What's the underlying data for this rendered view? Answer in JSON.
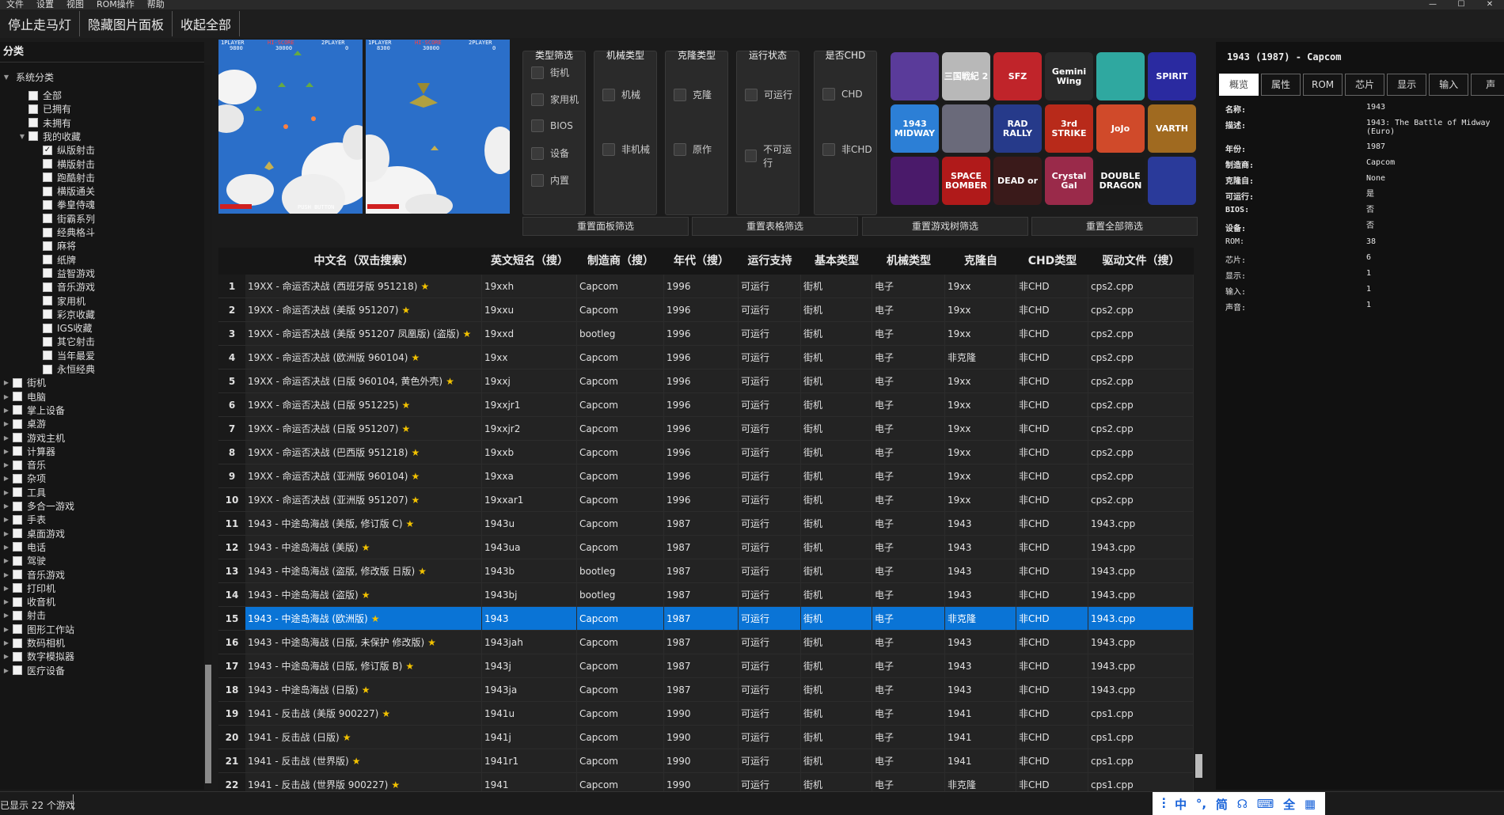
{
  "menu": [
    "文件",
    "设置",
    "视图",
    "ROM操作",
    "帮助"
  ],
  "window_controls": [
    "—",
    "☐",
    "✕"
  ],
  "toolbar": [
    "停止走马灯",
    "隐藏图片面板",
    "收起全部"
  ],
  "sidebar": {
    "title": "分类",
    "root": "系统分类",
    "items": [
      {
        "label": "全部",
        "level": 1,
        "checked": false,
        "arrow": ""
      },
      {
        "label": "已拥有",
        "level": 1,
        "checked": false,
        "arrow": ""
      },
      {
        "label": "未拥有",
        "level": 1,
        "checked": false,
        "arrow": ""
      },
      {
        "label": "我的收藏",
        "level": 1,
        "checked": false,
        "arrow": "▼"
      },
      {
        "label": "纵版射击",
        "level": 2,
        "checked": true,
        "arrow": ""
      },
      {
        "label": "横版射击",
        "level": 2,
        "checked": false,
        "arrow": ""
      },
      {
        "label": "跑酷射击",
        "level": 2,
        "checked": false,
        "arrow": ""
      },
      {
        "label": "横版通关",
        "level": 2,
        "checked": false,
        "arrow": ""
      },
      {
        "label": "拳皇侍魂",
        "level": 2,
        "checked": false,
        "arrow": ""
      },
      {
        "label": "街霸系列",
        "level": 2,
        "checked": false,
        "arrow": ""
      },
      {
        "label": "经典格斗",
        "level": 2,
        "checked": false,
        "arrow": ""
      },
      {
        "label": "麻将",
        "level": 2,
        "checked": false,
        "arrow": ""
      },
      {
        "label": "纸牌",
        "level": 2,
        "checked": false,
        "arrow": ""
      },
      {
        "label": "益智游戏",
        "level": 2,
        "checked": false,
        "arrow": ""
      },
      {
        "label": "音乐游戏",
        "level": 2,
        "checked": false,
        "arrow": ""
      },
      {
        "label": "家用机",
        "level": 2,
        "checked": false,
        "arrow": ""
      },
      {
        "label": "彩京收藏",
        "level": 2,
        "checked": false,
        "arrow": ""
      },
      {
        "label": "IGS收藏",
        "level": 2,
        "checked": false,
        "arrow": ""
      },
      {
        "label": "其它射击",
        "level": 2,
        "checked": false,
        "arrow": ""
      },
      {
        "label": "当年最爱",
        "level": 2,
        "checked": false,
        "arrow": ""
      },
      {
        "label": "永恒经典",
        "level": 2,
        "checked": false,
        "arrow": ""
      },
      {
        "label": "街机",
        "level": 0,
        "checked": false,
        "arrow": "▶"
      },
      {
        "label": "电脑",
        "level": 0,
        "checked": false,
        "arrow": "▶"
      },
      {
        "label": "掌上设备",
        "level": 0,
        "checked": false,
        "arrow": "▶"
      },
      {
        "label": "桌游",
        "level": 0,
        "checked": false,
        "arrow": "▶"
      },
      {
        "label": "游戏主机",
        "level": 0,
        "checked": false,
        "arrow": "▶"
      },
      {
        "label": "计算器",
        "level": 0,
        "checked": false,
        "arrow": "▶"
      },
      {
        "label": "音乐",
        "level": 0,
        "checked": false,
        "arrow": "▶"
      },
      {
        "label": "杂项",
        "level": 0,
        "checked": false,
        "arrow": "▶"
      },
      {
        "label": "工具",
        "level": 0,
        "checked": false,
        "arrow": "▶"
      },
      {
        "label": "多合一游戏",
        "level": 0,
        "checked": false,
        "arrow": "▶"
      },
      {
        "label": "手表",
        "level": 0,
        "checked": false,
        "arrow": "▶"
      },
      {
        "label": "桌面游戏",
        "level": 0,
        "checked": false,
        "arrow": "▶"
      },
      {
        "label": "电话",
        "level": 0,
        "checked": false,
        "arrow": "▶"
      },
      {
        "label": "驾驶",
        "level": 0,
        "checked": false,
        "arrow": "▶"
      },
      {
        "label": "音乐游戏",
        "level": 0,
        "checked": false,
        "arrow": "▶"
      },
      {
        "label": "打印机",
        "level": 0,
        "checked": false,
        "arrow": "▶"
      },
      {
        "label": "收音机",
        "level": 0,
        "checked": false,
        "arrow": "▶"
      },
      {
        "label": "射击",
        "level": 0,
        "checked": false,
        "arrow": "▶"
      },
      {
        "label": "图形工作站",
        "level": 0,
        "checked": false,
        "arrow": "▶"
      },
      {
        "label": "数码相机",
        "level": 0,
        "checked": false,
        "arrow": "▶"
      },
      {
        "label": "数字模拟器",
        "level": 0,
        "checked": false,
        "arrow": "▶"
      },
      {
        "label": "医疗设备",
        "level": 0,
        "checked": false,
        "arrow": "▶"
      }
    ]
  },
  "screenshots": [
    {
      "p1": "1PLAYER",
      "hi": "HI-SCORE",
      "p2": "2PLAYER",
      "s1": "9800",
      "shi": "30000",
      "s2": "0",
      "footer": "PUSH BUTTON"
    },
    {
      "p1": "1PLAYER",
      "hi": "HI-SCORE",
      "p2": "2PLAYER",
      "s1": "8300",
      "shi": "30000",
      "s2": "0",
      "footer": ""
    }
  ],
  "filters": [
    {
      "title": "类型筛选",
      "options": [
        "街机",
        "家用机",
        "BIOS",
        "设备",
        "内置"
      ]
    },
    {
      "title": "机械类型",
      "options": [
        "机械",
        "非机械"
      ]
    },
    {
      "title": "克隆类型",
      "options": [
        "克隆",
        "原作"
      ]
    },
    {
      "title": "运行状态",
      "options": [
        "可运行",
        "不可运行"
      ]
    },
    {
      "title": "是否CHD",
      "options": [
        "CHD",
        "非CHD"
      ]
    }
  ],
  "reset_buttons": [
    "重置面板筛选",
    "重置表格筛选",
    "重置游戏树筛选",
    "重置全部筛选"
  ],
  "covers": [
    {
      "label": "",
      "bg": "#5a3b9a"
    },
    {
      "label": "三国戦紀 2",
      "bg": "#b8b8b8"
    },
    {
      "label": "SFZ",
      "bg": "#c0242a"
    },
    {
      "label": "Gemini Wing",
      "bg": "#2a2a2a"
    },
    {
      "label": "",
      "bg": "#2fa8a0"
    },
    {
      "label": "SPIRIT",
      "bg": "#2a2aa0"
    },
    {
      "label": "1943 MIDWAY",
      "bg": "#2c7fd6"
    },
    {
      "label": "",
      "bg": "#6a6a7a"
    },
    {
      "label": "RAD RALLY",
      "bg": "#263a8a"
    },
    {
      "label": "3rd STRIKE",
      "bg": "#b82a1a"
    },
    {
      "label": "JoJo",
      "bg": "#d04a2a"
    },
    {
      "label": "VARTH",
      "bg": "#a06a20"
    },
    {
      "label": "",
      "bg": "#4a1a6a"
    },
    {
      "label": "SPACE BOMBER",
      "bg": "#b01a1a"
    },
    {
      "label": "DEAD or",
      "bg": "#3a1a1a"
    },
    {
      "label": "Crystal Gal",
      "bg": "#9a2a4a"
    },
    {
      "label": "DOUBLE DRAGON",
      "bg": "#1a1a1a"
    },
    {
      "label": "",
      "bg": "#2a3a9a"
    }
  ],
  "table": {
    "columns": [
      "",
      "中文名（双击搜索）",
      "英文短名（搜）",
      "制造商（搜）",
      "年代（搜）",
      "运行支持",
      "基本类型",
      "机械类型",
      "克隆自",
      "CHD类型",
      "驱动文件（搜）"
    ],
    "rows": [
      [
        "1",
        "19XX - 命运否决战 (西班牙版 951218)",
        "19xxh",
        "Capcom",
        "1996",
        "可运行",
        "街机",
        "电子",
        "19xx",
        "非CHD",
        "cps2.cpp"
      ],
      [
        "2",
        "19XX - 命运否决战 (美版 951207)",
        "19xxu",
        "Capcom",
        "1996",
        "可运行",
        "街机",
        "电子",
        "19xx",
        "非CHD",
        "cps2.cpp"
      ],
      [
        "3",
        "19XX - 命运否决战 (美版 951207 凤凰版) (盗版)",
        "19xxd",
        "bootleg",
        "1996",
        "可运行",
        "街机",
        "电子",
        "19xx",
        "非CHD",
        "cps2.cpp"
      ],
      [
        "4",
        "19XX - 命运否决战 (欧洲版 960104)",
        "19xx",
        "Capcom",
        "1996",
        "可运行",
        "街机",
        "电子",
        "非克隆",
        "非CHD",
        "cps2.cpp"
      ],
      [
        "5",
        "19XX - 命运否决战 (日版 960104, 黄色外壳)",
        "19xxj",
        "Capcom",
        "1996",
        "可运行",
        "街机",
        "电子",
        "19xx",
        "非CHD",
        "cps2.cpp"
      ],
      [
        "6",
        "19XX - 命运否决战 (日版 951225)",
        "19xxjr1",
        "Capcom",
        "1996",
        "可运行",
        "街机",
        "电子",
        "19xx",
        "非CHD",
        "cps2.cpp"
      ],
      [
        "7",
        "19XX - 命运否决战 (日版 951207)",
        "19xxjr2",
        "Capcom",
        "1996",
        "可运行",
        "街机",
        "电子",
        "19xx",
        "非CHD",
        "cps2.cpp"
      ],
      [
        "8",
        "19XX - 命运否决战 (巴西版 951218)",
        "19xxb",
        "Capcom",
        "1996",
        "可运行",
        "街机",
        "电子",
        "19xx",
        "非CHD",
        "cps2.cpp"
      ],
      [
        "9",
        "19XX - 命运否决战 (亚洲版 960104)",
        "19xxa",
        "Capcom",
        "1996",
        "可运行",
        "街机",
        "电子",
        "19xx",
        "非CHD",
        "cps2.cpp"
      ],
      [
        "10",
        "19XX - 命运否决战 (亚洲版 951207)",
        "19xxar1",
        "Capcom",
        "1996",
        "可运行",
        "街机",
        "电子",
        "19xx",
        "非CHD",
        "cps2.cpp"
      ],
      [
        "11",
        "1943 - 中途岛海战 (美版, 修订版 C)",
        "1943u",
        "Capcom",
        "1987",
        "可运行",
        "街机",
        "电子",
        "1943",
        "非CHD",
        "1943.cpp"
      ],
      [
        "12",
        "1943 - 中途岛海战 (美版)",
        "1943ua",
        "Capcom",
        "1987",
        "可运行",
        "街机",
        "电子",
        "1943",
        "非CHD",
        "1943.cpp"
      ],
      [
        "13",
        "1943 - 中途岛海战 (盗版, 修改版 日版)",
        "1943b",
        "bootleg",
        "1987",
        "可运行",
        "街机",
        "电子",
        "1943",
        "非CHD",
        "1943.cpp"
      ],
      [
        "14",
        "1943 - 中途岛海战 (盗版)",
        "1943bj",
        "bootleg",
        "1987",
        "可运行",
        "街机",
        "电子",
        "1943",
        "非CHD",
        "1943.cpp"
      ],
      [
        "15",
        "1943 - 中途岛海战 (欧洲版)",
        "1943",
        "Capcom",
        "1987",
        "可运行",
        "街机",
        "电子",
        "非克隆",
        "非CHD",
        "1943.cpp"
      ],
      [
        "16",
        "1943 - 中途岛海战 (日版, 未保护 修改版)",
        "1943jah",
        "Capcom",
        "1987",
        "可运行",
        "街机",
        "电子",
        "1943",
        "非CHD",
        "1943.cpp"
      ],
      [
        "17",
        "1943 - 中途岛海战 (日版, 修订版 B)",
        "1943j",
        "Capcom",
        "1987",
        "可运行",
        "街机",
        "电子",
        "1943",
        "非CHD",
        "1943.cpp"
      ],
      [
        "18",
        "1943 - 中途岛海战 (日版)",
        "1943ja",
        "Capcom",
        "1987",
        "可运行",
        "街机",
        "电子",
        "1943",
        "非CHD",
        "1943.cpp"
      ],
      [
        "19",
        "1941 - 反击战 (美版 900227)",
        "1941u",
        "Capcom",
        "1990",
        "可运行",
        "街机",
        "电子",
        "1941",
        "非CHD",
        "cps1.cpp"
      ],
      [
        "20",
        "1941 - 反击战 (日版)",
        "1941j",
        "Capcom",
        "1990",
        "可运行",
        "街机",
        "电子",
        "1941",
        "非CHD",
        "cps1.cpp"
      ],
      [
        "21",
        "1941 - 反击战 (世界版)",
        "1941r1",
        "Capcom",
        "1990",
        "可运行",
        "街机",
        "电子",
        "1941",
        "非CHD",
        "cps1.cpp"
      ],
      [
        "22",
        "1941 - 反击战 (世界版 900227)",
        "1941",
        "Capcom",
        "1990",
        "可运行",
        "街机",
        "电子",
        "非克隆",
        "非CHD",
        "cps1.cpp"
      ]
    ],
    "selected_row": 15,
    "star": "★"
  },
  "details": {
    "title": "1943 (1987) - Capcom",
    "tabs": [
      "概览",
      "属性",
      "ROM",
      "芯片",
      "显示",
      "输入",
      "声"
    ],
    "active_tab": "概览",
    "fields": [
      {
        "key": "名称:",
        "value": "1943",
        "bold": true
      },
      {
        "key": "描述:",
        "value": "1943: The Battle of Midway (Euro)",
        "bold": true
      },
      {
        "key": "年份:",
        "value": "1987",
        "bold": true
      },
      {
        "key": "制造商:",
        "value": "Capcom",
        "bold": true
      },
      {
        "key": "克隆自:",
        "value": "None",
        "bold": true
      },
      {
        "key": "可运行:",
        "value": "是",
        "bold": true
      },
      {
        "key": "BIOS:",
        "value": "否",
        "bold": true
      },
      {
        "key": "设备:",
        "value": "否",
        "bold": true
      },
      {
        "key": "ROM:",
        "value": "38",
        "bold": false
      },
      {
        "key": "芯片:",
        "value": "6",
        "bold": false
      },
      {
        "key": "显示:",
        "value": "1",
        "bold": false
      },
      {
        "key": "输入:",
        "value": "1",
        "bold": false
      },
      {
        "key": "声音:",
        "value": "1",
        "bold": false
      }
    ]
  },
  "status": {
    "text": "已显示 22 个游戏",
    "ime": [
      "中",
      "°,",
      "简",
      "☊",
      "⌨",
      "全",
      "▦"
    ]
  },
  "colors": {
    "selection": "#0a74d6",
    "star": "#f2c200",
    "background": "#1b1b1b"
  }
}
